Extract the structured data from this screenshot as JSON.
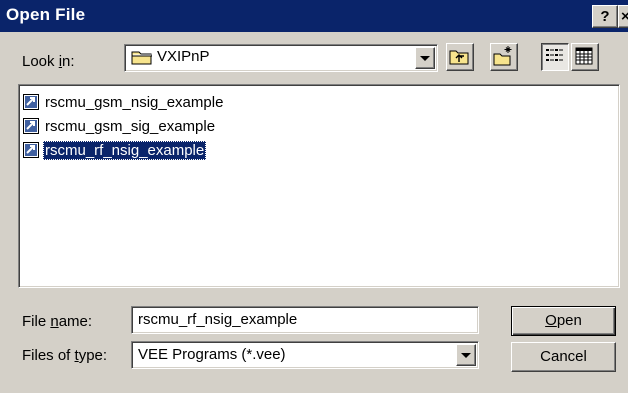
{
  "window": {
    "title": "Open File",
    "help_glyph": "?",
    "close_glyph": "×"
  },
  "look_in": {
    "label_pre": "Look ",
    "label_accel": "i",
    "label_post": "n:",
    "value": "VXIPnP",
    "icon": "folder-icon"
  },
  "toolbar": {
    "up_icon": "up-one-level-icon",
    "new_folder_icon": "new-folder-icon",
    "list_icon": "list-view-icon",
    "details_icon": "details-view-icon",
    "list_view_active": true
  },
  "files": [
    {
      "name": "rscmu_gsm_nsig_example",
      "selected": false,
      "icon": "vee-program-icon"
    },
    {
      "name": "rscmu_gsm_sig_example",
      "selected": false,
      "icon": "vee-program-icon"
    },
    {
      "name": "rscmu_rf_nsig_example",
      "selected": true,
      "icon": "vee-program-icon"
    }
  ],
  "file_name": {
    "label_pre": "File ",
    "label_accel": "n",
    "label_post": "ame:",
    "value": "rscmu_rf_nsig_example"
  },
  "file_type": {
    "label_pre": "Files of ",
    "label_accel": "t",
    "label_post": "ype:",
    "value": "VEE Programs (*.vee)"
  },
  "buttons": {
    "open_accel": "O",
    "open_rest": "pen",
    "cancel": "Cancel"
  },
  "colors": {
    "selection": "#0a246a",
    "face": "#d4d0c8"
  }
}
